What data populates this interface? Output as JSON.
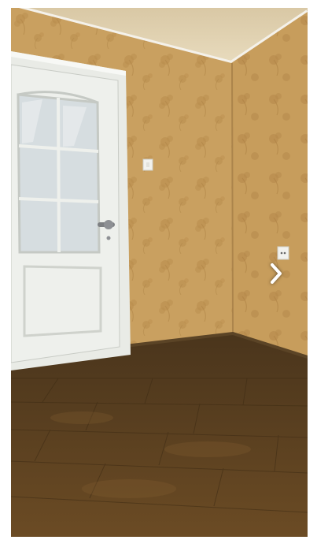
{
  "viewer": {
    "photo": {
      "subject": "room-interior-photo"
    },
    "controls": {
      "next_icon": "chevron-right-icon"
    },
    "colors": {
      "wallpaper": "#c9a060",
      "floor": "#5e4322",
      "door": "#eceeea",
      "ceiling": "#e6d7b8"
    }
  }
}
